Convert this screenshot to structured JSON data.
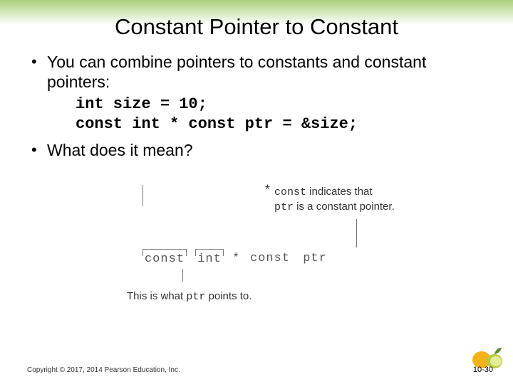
{
  "title": "Constant Pointer to Constant",
  "bullets": {
    "b1": "You can combine pointers to constants and constant pointers:",
    "b2": "What does it mean?"
  },
  "code": {
    "line1": "int size = 10;",
    "line2": "const int * const ptr = &size;"
  },
  "diagram": {
    "annot_top_1": "const",
    "annot_top_2": " indicates that ",
    "annot_top_3": "ptr",
    "annot_top_4": " is a constant pointer.",
    "annot_top_star": "*",
    "seg_const": "const",
    "seg_int": "int",
    "seg_star": "*",
    "seg_const2": "const",
    "seg_ptr": "ptr",
    "annot_bottom_1": "This is what ",
    "annot_bottom_2": "ptr",
    "annot_bottom_3": " points to."
  },
  "footer": "Copyright © 2017, 2014 Pearson Education, Inc.",
  "page": "10-30"
}
